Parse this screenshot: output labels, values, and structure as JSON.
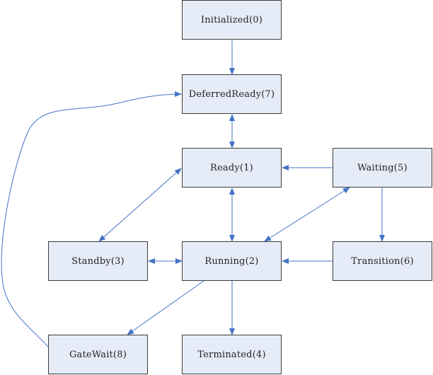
{
  "colors": {
    "edge": "#4472c4",
    "node_fill": "#e6ecf7",
    "node_border": "#3c3c3c"
  },
  "nodes": {
    "initialized": "Initialized(0)",
    "deferred_ready": "DeferredReady(7)",
    "ready": "Ready(1)",
    "waiting": "Waiting(5)",
    "standby": "Standby(3)",
    "running": "Running(2)",
    "transition": "Transition(6)",
    "gatewait": "GateWait(8)",
    "terminated": "Terminated(4)"
  },
  "edges": [
    {
      "from": "initialized",
      "to": "deferred_ready",
      "bidirectional": false
    },
    {
      "from": "deferred_ready",
      "to": "ready",
      "bidirectional": true
    },
    {
      "from": "waiting",
      "to": "ready",
      "bidirectional": false
    },
    {
      "from": "ready",
      "to": "standby",
      "bidirectional": true
    },
    {
      "from": "ready",
      "to": "running",
      "bidirectional": true
    },
    {
      "from": "waiting",
      "to": "running",
      "bidirectional": true
    },
    {
      "from": "waiting",
      "to": "transition",
      "bidirectional": false
    },
    {
      "from": "transition",
      "to": "running",
      "bidirectional": false
    },
    {
      "from": "standby",
      "to": "running",
      "bidirectional": true
    },
    {
      "from": "running",
      "to": "gatewait",
      "bidirectional": false
    },
    {
      "from": "running",
      "to": "terminated",
      "bidirectional": false
    },
    {
      "from": "gatewait",
      "to": "deferred_ready",
      "bidirectional": false
    }
  ]
}
